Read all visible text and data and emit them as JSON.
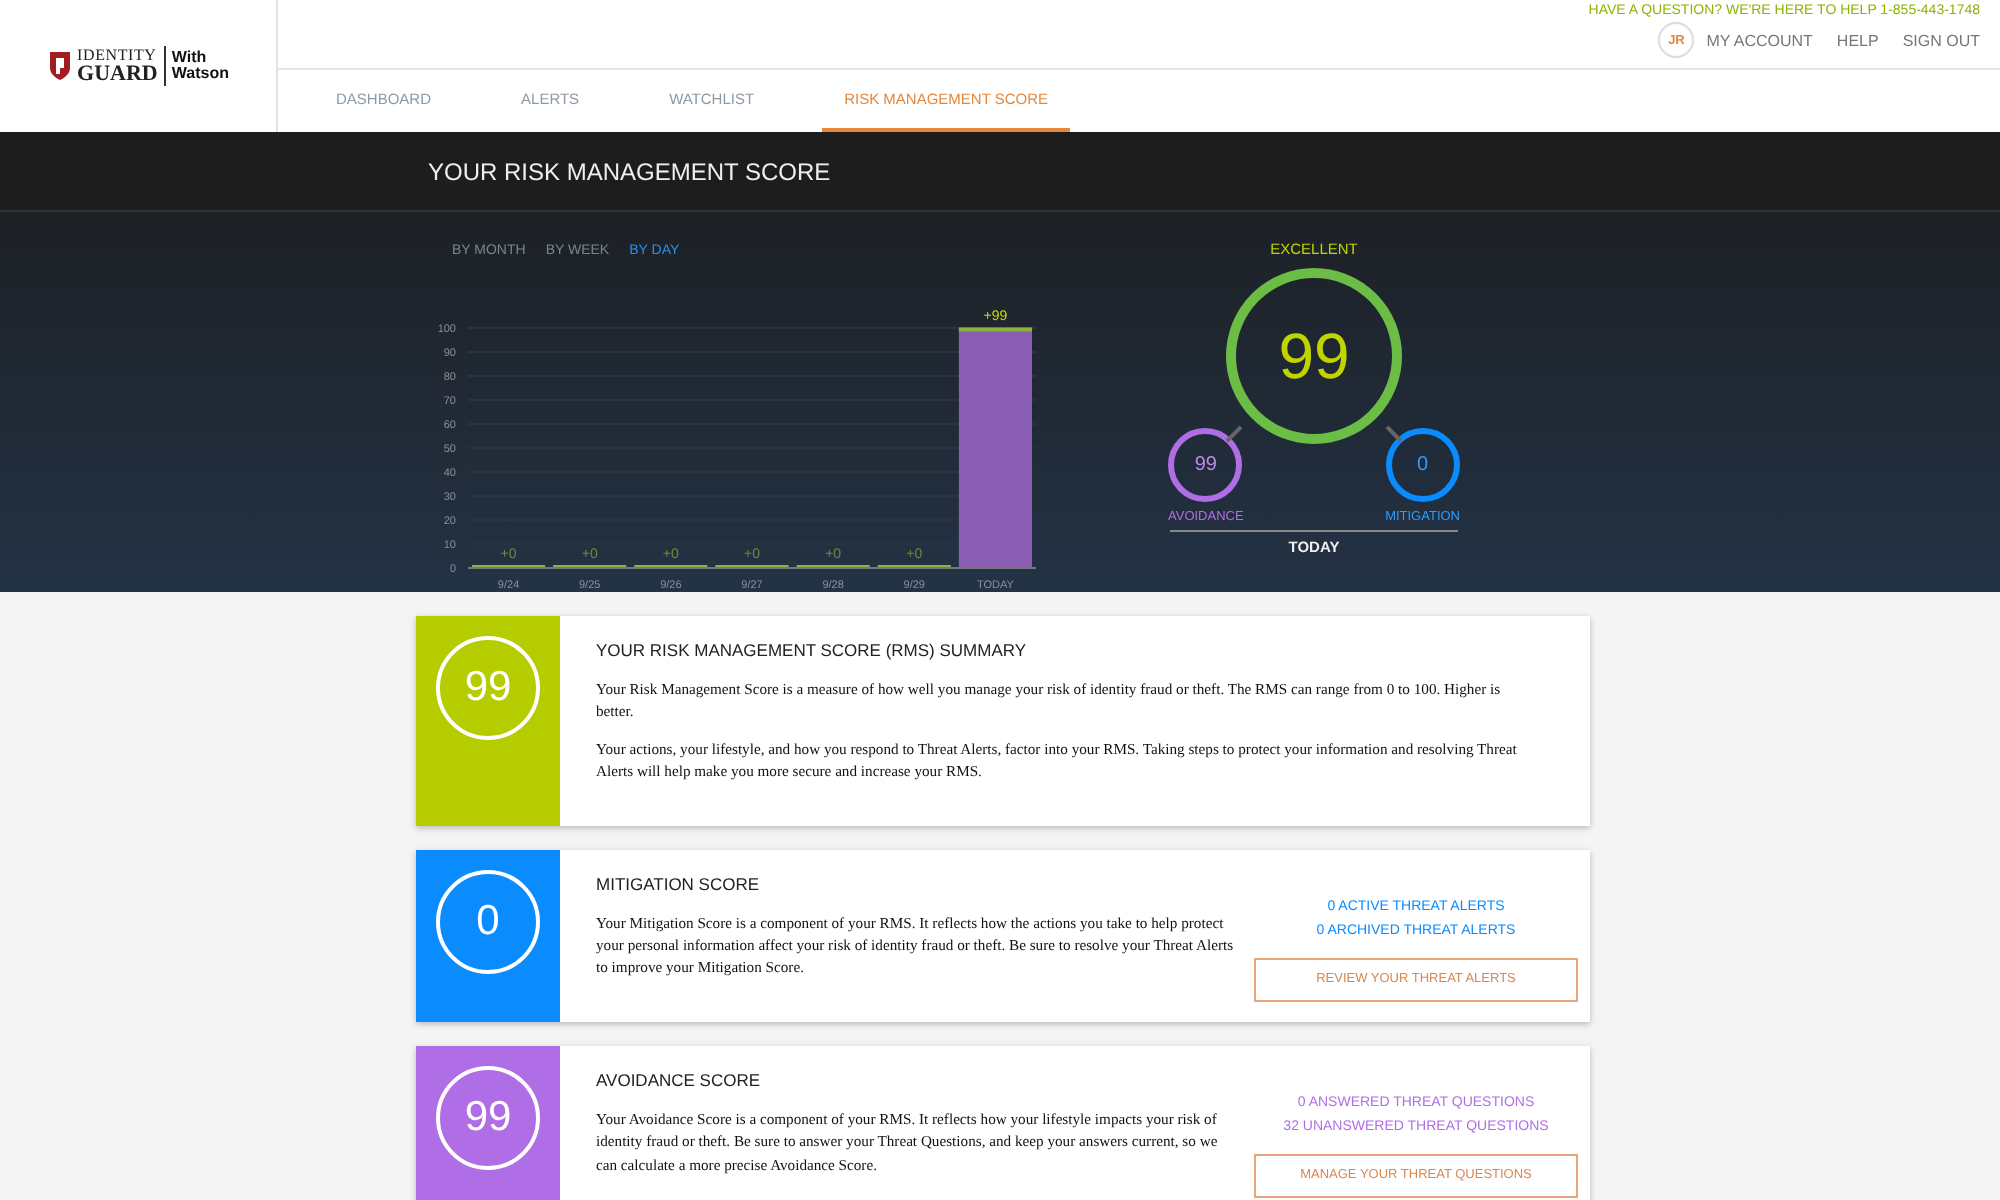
{
  "header": {
    "logo": {
      "brand_top": "IDENTITY",
      "brand_bottom": "GUARD",
      "partner_top": "With",
      "partner_bottom": "Watson"
    },
    "contact": "HAVE A QUESTION? WE'RE HERE TO HELP 1-855-443-1748",
    "avatar": "JR",
    "links": [
      "MY ACCOUNT",
      "HELP",
      "SIGN OUT"
    ],
    "tabs": [
      {
        "label": "DASHBOARD",
        "selected": false
      },
      {
        "label": "ALERTS",
        "selected": false
      },
      {
        "label": "WATCHLIST",
        "selected": false
      },
      {
        "label": "RISK MANAGEMENT SCORE",
        "selected": true
      }
    ]
  },
  "hero": {
    "title": "YOUR RISK MANAGEMENT SCORE",
    "periods": [
      {
        "label": "BY MONTH",
        "selected": false
      },
      {
        "label": "BY WEEK",
        "selected": false
      },
      {
        "label": "BY DAY",
        "selected": true
      }
    ],
    "chart_data": {
      "type": "bar",
      "categories": [
        "9/24",
        "9/25",
        "9/26",
        "9/27",
        "9/28",
        "9/29",
        "TODAY"
      ],
      "ylim": [
        0,
        100
      ],
      "yticks": [
        0,
        10,
        20,
        30,
        40,
        50,
        60,
        70,
        80,
        90,
        100
      ],
      "grid": true,
      "series": [
        {
          "color": "#8a5db5",
          "values": [
            0,
            0,
            0,
            0,
            0,
            0,
            99
          ]
        }
      ],
      "value_labels": [
        "+0",
        "+0",
        "+0",
        "+0",
        "+0",
        "+0",
        "+99"
      ]
    },
    "score": {
      "rating": "EXCELLENT",
      "value": "99",
      "avoidance": {
        "value": "99",
        "label": "AVOIDANCE"
      },
      "mitigation": {
        "value": "0",
        "label": "MITIGATION"
      },
      "period": "TODAY"
    }
  },
  "cards": [
    {
      "score": "99",
      "color": "#b5cc00",
      "title": "YOUR RISK MANAGEMENT SCORE (RMS) SUMMARY",
      "paragraphs": [
        "Your Risk Management Score is a measure of how well you manage your risk of identity fraud or theft. The RMS can range from 0 to 100. Higher is better.",
        "Your actions, your lifestyle, and how you respond to Threat Alerts, factor into your RMS. Taking steps to protect your information and resolving Threat Alerts will help make you more secure and increase your RMS."
      ]
    },
    {
      "score": "0",
      "color": "#0a8cff",
      "title": "MITIGATION SCORE",
      "paragraphs": [
        "Your Mitigation Score is a component of your RMS. It reflects how the actions you take to help protect your personal information affect your risk of identity fraud or theft. Be sure to resolve your Threat Alerts to improve your Mitigation Score."
      ],
      "links": [
        "0 ACTIVE THREAT ALERTS",
        "0 ARCHIVED THREAT ALERTS"
      ],
      "button": "REVIEW YOUR THREAT ALERTS"
    },
    {
      "score": "99",
      "color": "#b06ee6",
      "title": "AVOIDANCE SCORE",
      "paragraphs": [
        "Your Avoidance Score is a component of your RMS. It reflects how your lifestyle impacts your risk of identity fraud or theft. Be sure to answer your Threat Questions, and keep your answers current, so we can calculate a more precise Avoidance Score."
      ],
      "links": [
        "0 ANSWERED THREAT QUESTIONS",
        "32 UNANSWERED THREAT QUESTIONS"
      ],
      "button": "MANAGE YOUR THREAT QUESTIONS"
    }
  ]
}
